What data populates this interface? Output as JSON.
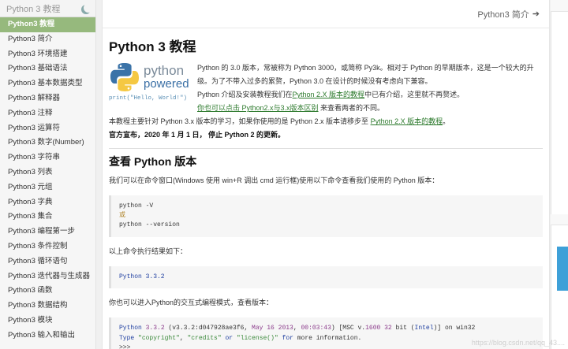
{
  "sidebar": {
    "header_title": "Python 3 教程",
    "items": [
      {
        "label": "Python3 教程",
        "active": true
      },
      {
        "label": "Python3 简介"
      },
      {
        "label": "Python3 环境搭建"
      },
      {
        "label": "Python3 基础语法"
      },
      {
        "label": "Python3 基本数据类型"
      },
      {
        "label": "Python3 解释器"
      },
      {
        "label": "Python3 注释"
      },
      {
        "label": "Python3 运算符"
      },
      {
        "label": "Python3 数字(Number)"
      },
      {
        "label": "Python3 字符串"
      },
      {
        "label": "Python3 列表"
      },
      {
        "label": "Python3 元组"
      },
      {
        "label": "Python3 字典"
      },
      {
        "label": "Python3 集合"
      },
      {
        "label": "Python3 编程第一步"
      },
      {
        "label": "Python3 条件控制"
      },
      {
        "label": "Python3 循环语句"
      },
      {
        "label": "Python3 迭代器与生成器"
      },
      {
        "label": "Python3 函数"
      },
      {
        "label": "Python3 数据结构"
      },
      {
        "label": "Python3 模块"
      },
      {
        "label": "Python3 输入和输出"
      }
    ]
  },
  "nav": {
    "next_label": "Python3 简介"
  },
  "article": {
    "title": "Python 3 教程",
    "logo": {
      "word1": "python",
      "word2": "powered",
      "code": "print(\"Hello, World!\")"
    },
    "intro1": "Python 的 3.0 版本，常被称为 Python 3000，或简称 Py3k。相对于 Python 的早期版本，这是一个较大的升级。为了不带入过多的累赘，Python 3.0 在设计的时候没有考虑向下兼容。",
    "intro2_pre": "Python 介绍及安装教程我们在",
    "intro2_link": "Python 2.X 版本的教程",
    "intro2_post": "中已有介绍，这里就不再赘述。",
    "intro3_link": "你也可以点击 Python2.x与3.x版本区别",
    "intro3_post": " 来查看两者的不同。",
    "para1_pre": "本教程主要针对 Python 3.x 版本的学习，如果你使用的是 Python 2.x 版本请移步至 ",
    "para1_link": "Python 2.X 版本的教程",
    "para1_post": "。",
    "para2": "官方宣布，2020 年 1 月 1 日， 停止 Python 2 的更新。",
    "h2": "查看 Python 版本",
    "para3": "我们可以在命令窗口(Windows 使用 win+R 调出 cmd 运行框)使用以下命令查看我们使用的 Python 版本：",
    "code1": {
      "line1": "python -V",
      "line2": "或",
      "line3": "python --version"
    },
    "para4": "以上命令执行结果如下：",
    "code2": "Python 3.3.2",
    "para5": "你也可以进入Python的交互式编程模式，查看版本：",
    "code3": {
      "a1": "Python ",
      "a2": "3.3.2",
      "a3": " (v3.3.2:d047928ae3f6, ",
      "a4": "May 16 2013",
      "a5": ", ",
      "a6": "00:03:43",
      "a7": ") [MSC v.",
      "a8": "1600",
      "a9": " ",
      "a10": "32",
      "a11": " bit (",
      "a12": "Intel",
      "a13": ")] on win32",
      "b1": "Type ",
      "b2": "\"copyright\"",
      "b3": ", ",
      "b4": "\"credits\"",
      "b5": " ",
      "b6": "or",
      "b7": " ",
      "b8": "\"license()\"",
      "b9": " ",
      "b10": "for",
      "b11": " more information.",
      "c1": ">>>"
    }
  },
  "watermark": "https://blog.csdn.net/qq_43...."
}
